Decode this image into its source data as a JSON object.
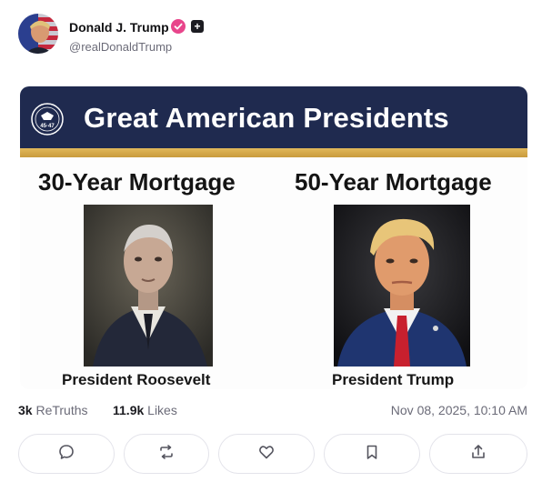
{
  "post": {
    "author": {
      "display_name": "Donald J. Trump",
      "handle": "@realDonaldTrump",
      "verified_color": "#e8458b"
    },
    "image": {
      "banner_title": "Great American Presidents",
      "seal_text": "45·47",
      "left": {
        "heading": "30-Year Mortgage",
        "caption": "President Roosevelt"
      },
      "right": {
        "heading": "50-Year Mortgage",
        "caption": "President Trump"
      }
    },
    "stats": {
      "retruths_count": "3k",
      "retruths_label": "ReTruths",
      "likes_count": "11.9k",
      "likes_label": "Likes",
      "timestamp": "Nov 08, 2025, 10:10 AM"
    },
    "actions": [
      {
        "icon": "comment-icon"
      },
      {
        "icon": "retruth-icon"
      },
      {
        "icon": "heart-icon"
      },
      {
        "icon": "bookmark-icon"
      },
      {
        "icon": "share-icon"
      }
    ]
  }
}
